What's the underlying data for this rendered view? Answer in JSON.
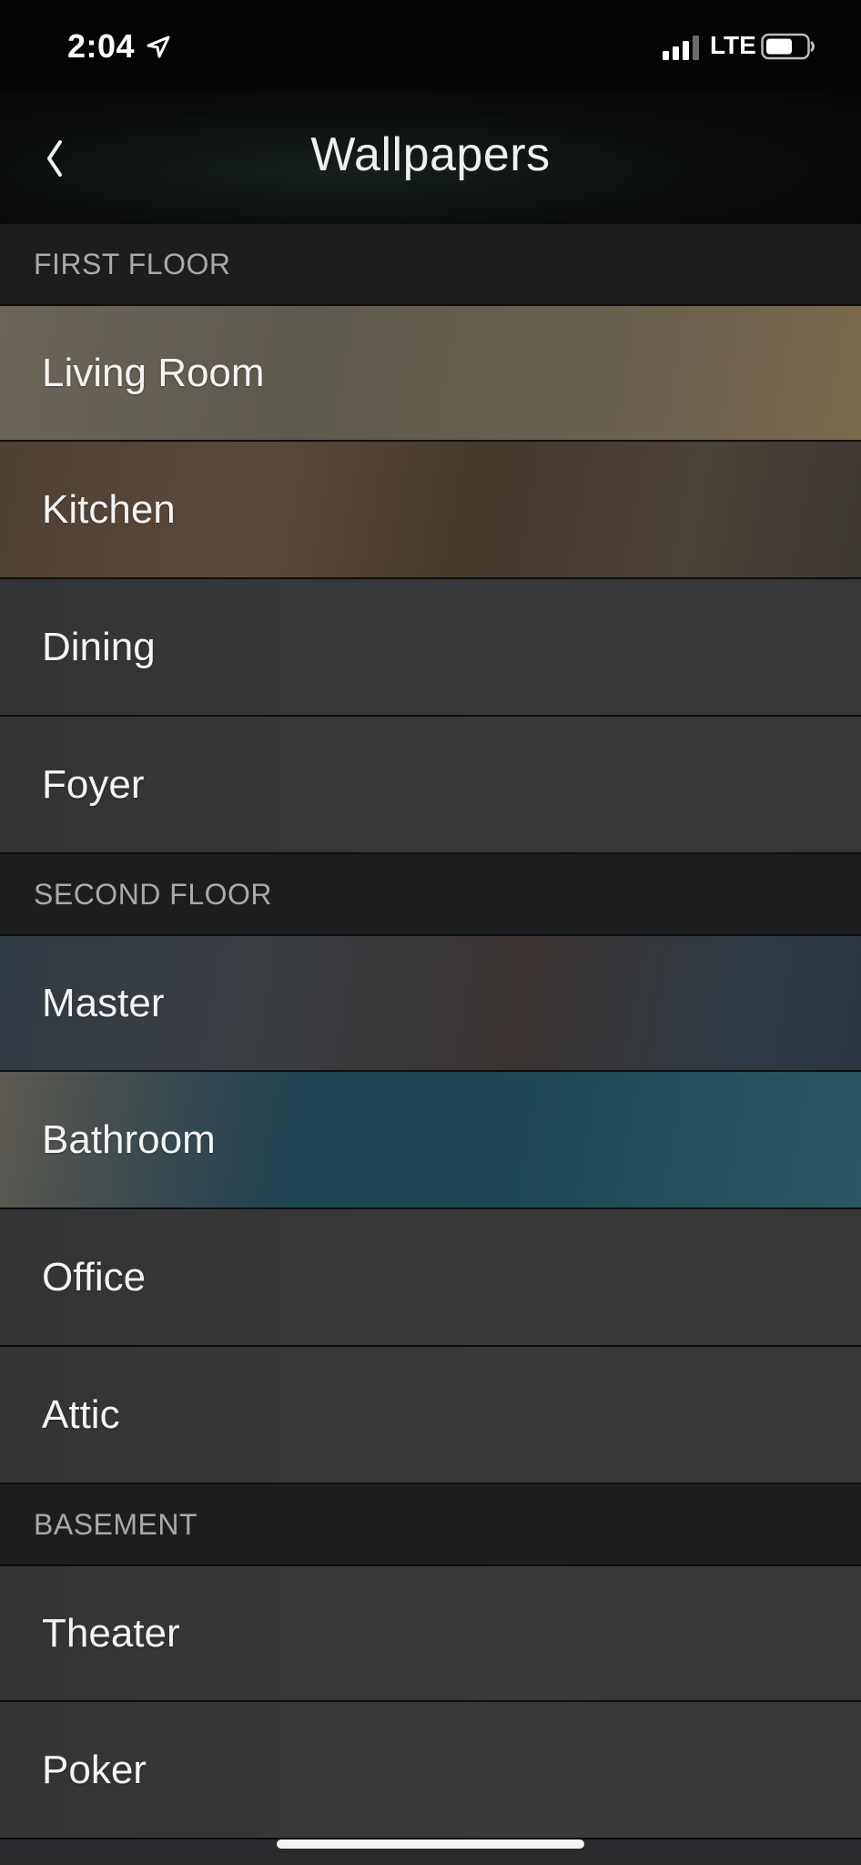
{
  "status_bar": {
    "time": "2:04",
    "network": "LTE",
    "icons": [
      "location-arrow-icon",
      "cellular-signal-icon",
      "battery-icon"
    ]
  },
  "nav": {
    "title": "Wallpapers",
    "back_icon": "chevron-left-icon"
  },
  "sections": [
    {
      "title": "FIRST FLOOR",
      "items": [
        "Living Room",
        "Kitchen",
        "Dining",
        "Foyer"
      ]
    },
    {
      "title": "SECOND FLOOR",
      "items": [
        "Master",
        "Bathroom",
        "Office",
        "Attic"
      ]
    },
    {
      "title": "BASEMENT",
      "items": [
        "Theater",
        "Poker"
      ]
    }
  ],
  "colors": {
    "background": "#2e2f31",
    "section_header": "#1c1d1e",
    "text": "#f4f4f4",
    "section_text": "#a9aaab"
  }
}
